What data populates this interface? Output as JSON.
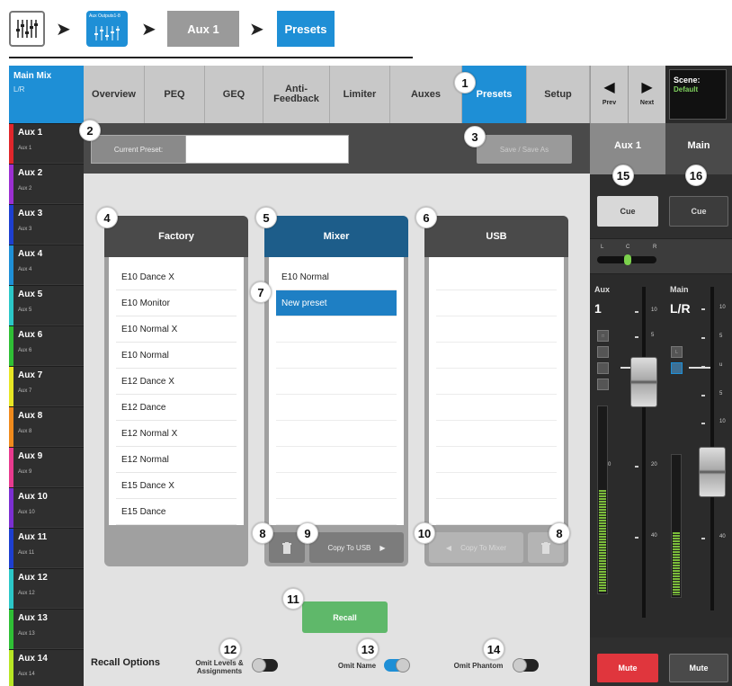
{
  "breadcrumb": {
    "step2_label": "Aux Outputs1-8",
    "step3_label": "Aux 1",
    "step4_label": "Presets"
  },
  "sidebar": {
    "main": {
      "title": "Main Mix",
      "sub": "L/R"
    },
    "items": [
      {
        "title": "Aux 1",
        "sub": "Aux 1",
        "color": "#e0262b"
      },
      {
        "title": "Aux 2",
        "sub": "Aux 2",
        "color": "#9b2fd1"
      },
      {
        "title": "Aux 3",
        "sub": "Aux 3",
        "color": "#1d3fd0"
      },
      {
        "title": "Aux 4",
        "sub": "Aux 4",
        "color": "#1e8fd6"
      },
      {
        "title": "Aux 5",
        "sub": "Aux 5",
        "color": "#2bc7c7"
      },
      {
        "title": "Aux 6",
        "sub": "Aux 6",
        "color": "#2fbf35"
      },
      {
        "title": "Aux 7",
        "sub": "Aux 7",
        "color": "#e7e624"
      },
      {
        "title": "Aux 8",
        "sub": "Aux 8",
        "color": "#f08a1c"
      },
      {
        "title": "Aux 9",
        "sub": "Aux 9",
        "color": "#e83a8e"
      },
      {
        "title": "Aux 10",
        "sub": "Aux 10",
        "color": "#7b2fd1"
      },
      {
        "title": "Aux 11",
        "sub": "Aux 11",
        "color": "#1d3fd0"
      },
      {
        "title": "Aux 12",
        "sub": "Aux 12",
        "color": "#2bc7c7"
      },
      {
        "title": "Aux 13",
        "sub": "Aux 13",
        "color": "#2fbf35"
      },
      {
        "title": "Aux 14",
        "sub": "Aux 14",
        "color": "#b7e624"
      }
    ]
  },
  "tabs": [
    {
      "label": "Overview"
    },
    {
      "label": "PEQ"
    },
    {
      "label": "GEQ"
    },
    {
      "label": "Anti-\nFeedback"
    },
    {
      "label": "Limiter"
    },
    {
      "label": "Auxes"
    },
    {
      "label": "Presets"
    },
    {
      "label": "Setup"
    }
  ],
  "nav": {
    "prev": "Prev",
    "next": "Next"
  },
  "scene": {
    "label": "Scene:",
    "value": "Default"
  },
  "preset": {
    "current_label": "Current Preset:",
    "current_value": "",
    "save_label": "Save / Save As"
  },
  "panels": {
    "factory": {
      "title": "Factory",
      "items": [
        "E10 Dance X",
        "E10 Monitor",
        "E10 Normal X",
        "E10 Normal",
        "E12 Dance X",
        "E12 Dance",
        "E12 Normal X",
        "E12 Normal",
        "E15 Dance X",
        "E15 Dance"
      ]
    },
    "mixer": {
      "title": "Mixer",
      "items": [
        "E10 Normal",
        "New preset"
      ],
      "copy_label": "Copy To USB"
    },
    "usb": {
      "title": "USB",
      "items": [],
      "copy_label": "Copy To Mixer"
    }
  },
  "recall": {
    "button": "Recall",
    "title": "Recall Options",
    "opt1": "Omit Levels &\nAssignments",
    "opt2": "Omit Name",
    "opt3": "Omit Phantom"
  },
  "strip_aux": {
    "name": "Aux 1",
    "cue": "Cue",
    "pan_l": "L",
    "pan_c": "C",
    "pan_r": "R",
    "type": "Aux",
    "channel": "1",
    "scale": [
      "10",
      "5",
      "u",
      "0",
      "20",
      "40"
    ],
    "mute": "Mute",
    "fader_level": 0.6,
    "meter_level": 0.55
  },
  "strip_main": {
    "name": "Main",
    "cue": "Cue",
    "type": "Main",
    "channel": "L/R",
    "scale": [
      "10",
      "5",
      "u",
      "5",
      "10",
      "20",
      "40"
    ],
    "mute": "Mute",
    "fader_level": 0.4,
    "meter_level": 0.45
  },
  "callouts": [
    "1",
    "2",
    "3",
    "4",
    "5",
    "6",
    "7",
    "8",
    "9",
    "10",
    "8",
    "11",
    "12",
    "13",
    "14",
    "15",
    "16"
  ],
  "colors": {
    "accent": "#1e8fd6",
    "mute_aux": "#e0363d",
    "mute_main": "#555555",
    "recall": "#5fb86a"
  }
}
